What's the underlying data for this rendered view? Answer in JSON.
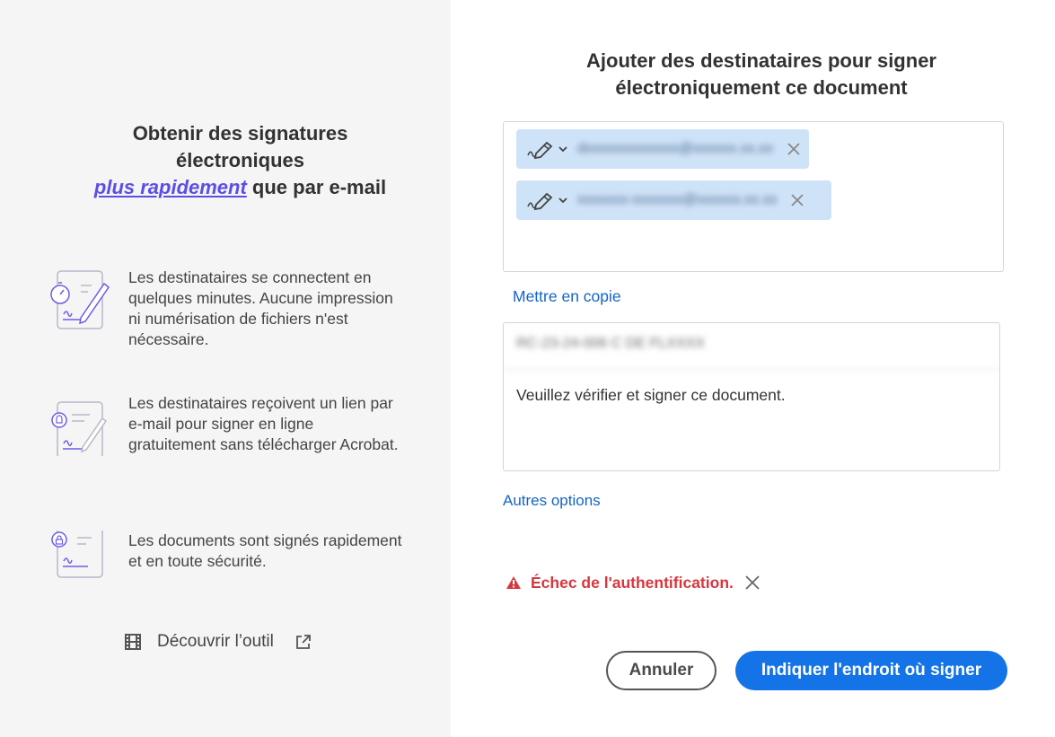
{
  "left": {
    "title": {
      "line1": "Obtenir des signatures",
      "line2": "électroniques",
      "highlight": "plus rapidement",
      "rest": " que par e-mail"
    },
    "features": [
      {
        "icon": "stopwatch-document-pen-icon",
        "text": "Les destinataires se connectent en quelques minutes. Aucune impression ni numérisation de fichiers n'est nécessaire."
      },
      {
        "icon": "notification-document-pen-icon",
        "text": "Les destinataires reçoivent un lien par e-mail pour signer en ligne gratuitement sans télécharger Acrobat."
      },
      {
        "icon": "lock-document-icon",
        "text": "Les documents sont signés rapidement et en toute sécurité."
      }
    ],
    "discover": {
      "label": "Découvrir l’outil",
      "icon": "film-icon",
      "external_icon": "external-link-icon"
    }
  },
  "right": {
    "title": "Ajouter des destinataires pour signer électroniquement ce document",
    "recipients": [
      {
        "email": "dxxxxxxxxxxxxx@xxxxxx.xx.xx",
        "role_icon": "signer-pen-icon"
      },
      {
        "email": "xxxxxxx-xxxxxxx@xxxxxx.xx.xx",
        "role_icon": "signer-pen-icon"
      }
    ],
    "cc_label": "Mettre en copie",
    "subject": "RC-23-24-006 C DE FLXXXX",
    "message": "Veuillez vérifier et signer ce document.",
    "more_options": "Autres options",
    "error": "Échec de l'authentification.",
    "cancel_label": "Annuler",
    "primary_label": "Indiquer l'endroit où signer",
    "colors": {
      "accent": "#1473e6",
      "error": "#d7373f",
      "highlight": "#5c4ee5",
      "chip": "#cfe3f8"
    }
  }
}
